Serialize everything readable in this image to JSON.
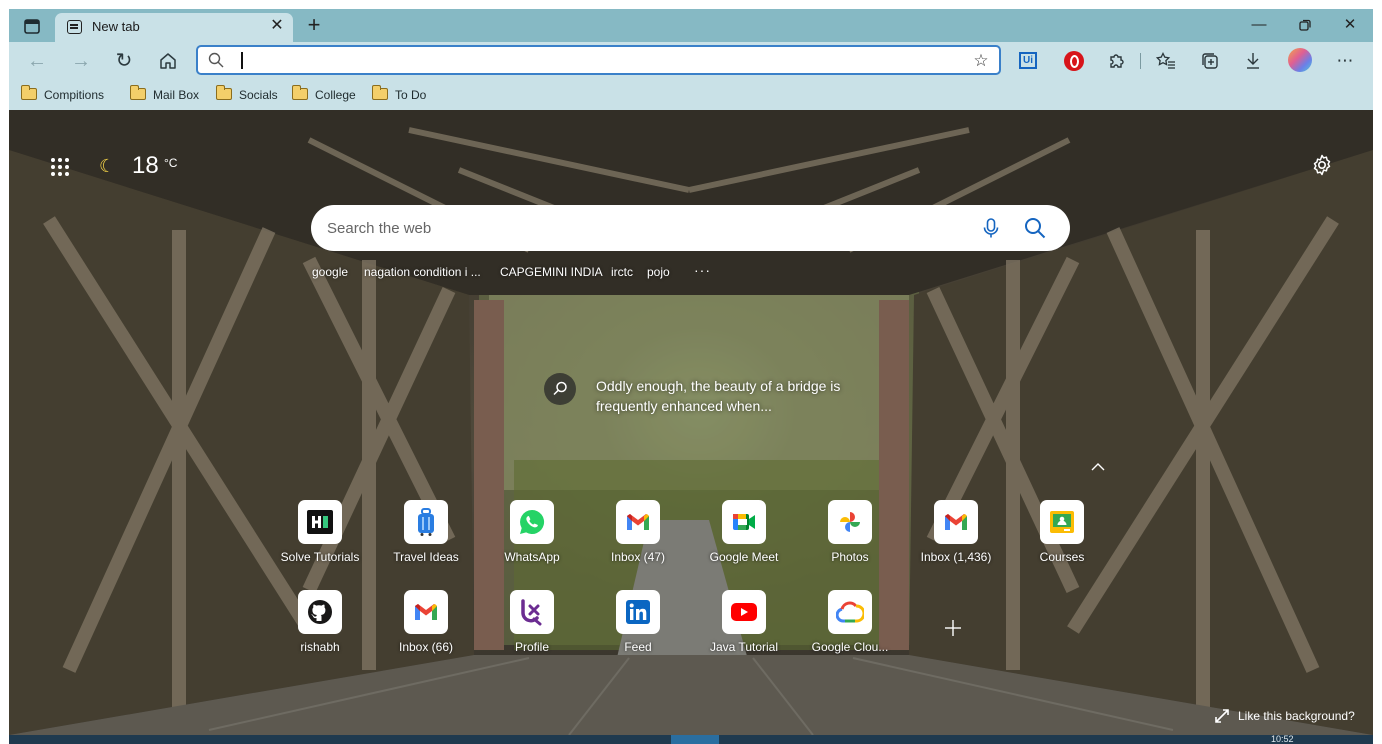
{
  "tab": {
    "title": "New tab",
    "close": "✕"
  },
  "toolbar": {
    "back": "←",
    "forward": "→",
    "refresh": "↻",
    "home": "⌂",
    "address_value": "",
    "more": "⋯"
  },
  "extensions": {
    "ui_label": "Ui"
  },
  "bookmarks": [
    {
      "label": "Compitions"
    },
    {
      "label": "Mail Box"
    },
    {
      "label": "Socials"
    },
    {
      "label": "College"
    },
    {
      "label": "To Do"
    }
  ],
  "weather": {
    "temperature": "18",
    "unit": "°C"
  },
  "search": {
    "placeholder": "Search the web",
    "suggestions": [
      "google",
      "nagation condition i ...",
      "CAPGEMINI INDIA",
      "irctc",
      "pojo"
    ],
    "more": "···"
  },
  "image_info": {
    "text": "Oddly enough, the beauty of a bridge is frequently enhanced when..."
  },
  "quick_links": [
    {
      "label": "Solve Tutorials",
      "icon": "solve-tutorials-icon"
    },
    {
      "label": "Travel Ideas",
      "icon": "luggage-icon"
    },
    {
      "label": "WhatsApp",
      "icon": "whatsapp-icon"
    },
    {
      "label": "Inbox (47)",
      "icon": "gmail-icon"
    },
    {
      "label": "Google Meet",
      "icon": "google-meet-icon"
    },
    {
      "label": "Photos",
      "icon": "google-photos-icon"
    },
    {
      "label": "Inbox (1,436)",
      "icon": "gmail-icon"
    },
    {
      "label": "Courses",
      "icon": "google-classroom-icon"
    },
    {
      "label": "rishabh",
      "icon": "github-icon"
    },
    {
      "label": "Inbox (66)",
      "icon": "gmail-icon"
    },
    {
      "label": "Profile",
      "icon": "profile-logo-icon"
    },
    {
      "label": "Feed",
      "icon": "linkedin-icon"
    },
    {
      "label": "Java Tutorial",
      "icon": "youtube-icon"
    },
    {
      "label": "Google Clou...",
      "icon": "google-cloud-icon"
    }
  ],
  "background": {
    "like_label": "Like this background?"
  },
  "taskbar": {
    "clock": "10:52"
  }
}
